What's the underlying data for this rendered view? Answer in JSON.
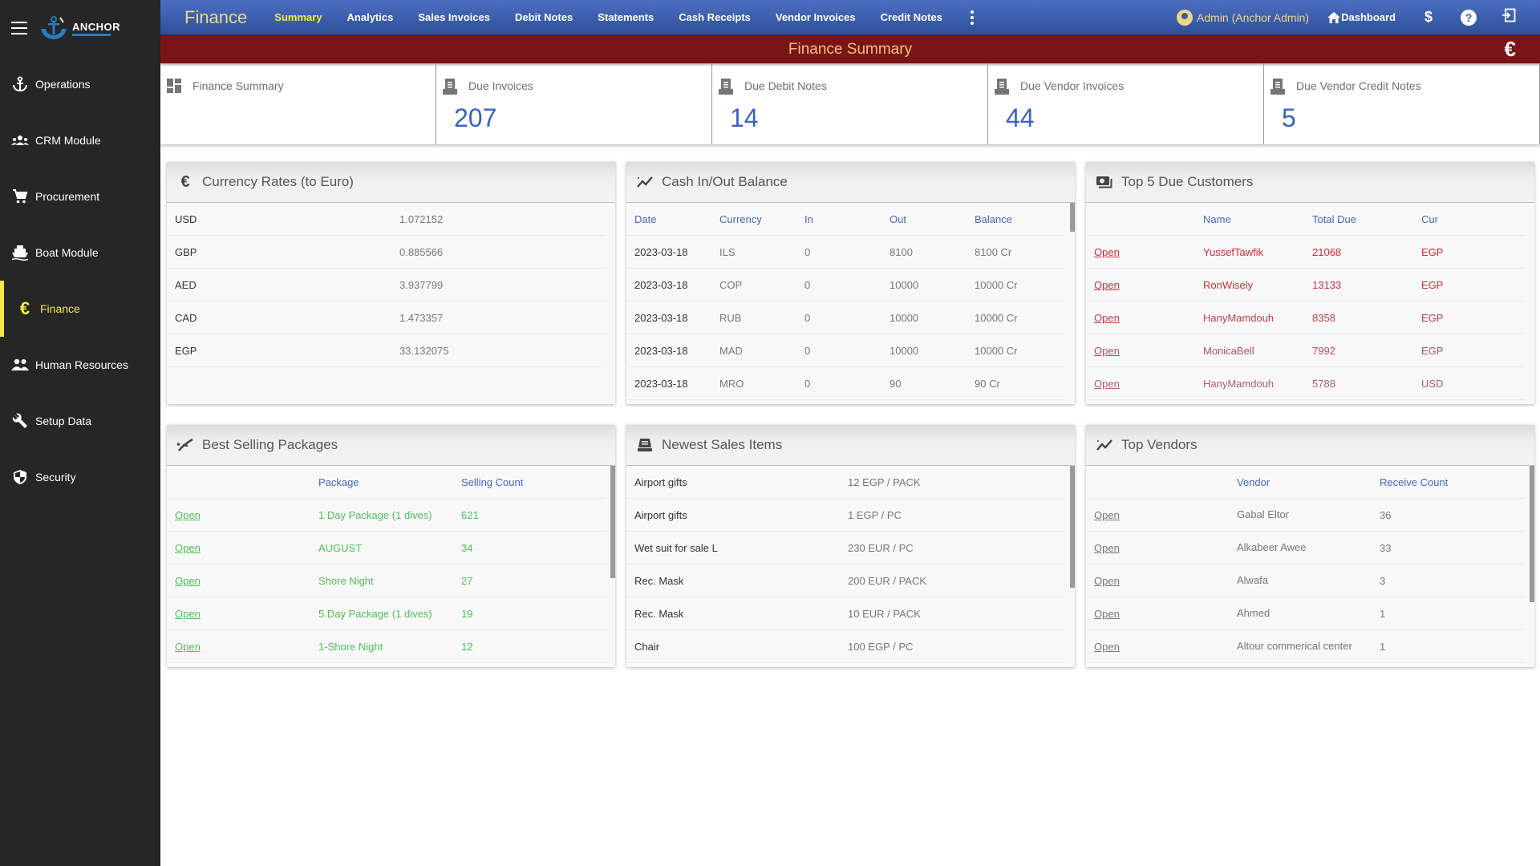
{
  "sidebar": {
    "logo_text": "ANCHOR",
    "items": [
      {
        "label": "Operations",
        "icon": "anchor-icon"
      },
      {
        "label": "CRM Module",
        "icon": "group-icon"
      },
      {
        "label": "Procurement",
        "icon": "cart-icon"
      },
      {
        "label": "Boat Module",
        "icon": "boat-icon"
      },
      {
        "label": "Finance",
        "icon": "euro-icon",
        "active": true
      },
      {
        "label": "Human Resources",
        "icon": "people-icon"
      },
      {
        "label": "Setup Data",
        "icon": "wrench-icon"
      },
      {
        "label": "Security",
        "icon": "shield-icon"
      }
    ]
  },
  "topnav": {
    "brand": "Finance",
    "links": [
      "Summary",
      "Analytics",
      "Sales Invoices",
      "Debit Notes",
      "Statements",
      "Cash Receipts",
      "Vendor Invoices",
      "Credit Notes"
    ],
    "active": "Summary",
    "user": "Admin (Anchor Admin)",
    "dashboard": "Dashboard",
    "dollar": "$",
    "help": "?"
  },
  "titlebar": {
    "title": "Finance Summary",
    "icon": "€"
  },
  "cards": [
    {
      "label": "Finance Summary",
      "value": null,
      "icon": "dashboard-icon"
    },
    {
      "label": "Due Invoices",
      "value": "207",
      "icon": "receipt-icon"
    },
    {
      "label": "Due Debit Notes",
      "value": "14",
      "icon": "receipt-icon"
    },
    {
      "label": "Due Vendor Invoices",
      "value": "44",
      "icon": "receipt-icon"
    },
    {
      "label": "Due Vendor Credit Notes",
      "value": "5",
      "icon": "receipt-icon"
    }
  ],
  "currency_rates": {
    "title": "Currency Rates (to Euro)",
    "icon": "€",
    "rows": [
      {
        "code": "USD",
        "rate": "1.072152"
      },
      {
        "code": "GBP",
        "rate": "0.885566"
      },
      {
        "code": "AED",
        "rate": "3.937799"
      },
      {
        "code": "CAD",
        "rate": "1.473357"
      },
      {
        "code": "EGP",
        "rate": "33.132075"
      }
    ]
  },
  "cash_balance": {
    "title": "Cash In/Out Balance",
    "headers": [
      "Date",
      "Currency",
      "In",
      "Out",
      "Balance"
    ],
    "rows": [
      [
        "2023-03-18",
        "ILS",
        "0",
        "8100",
        "8100 Cr"
      ],
      [
        "2023-03-18",
        "COP",
        "0",
        "10000",
        "10000 Cr"
      ],
      [
        "2023-03-18",
        "RUB",
        "0",
        "10000",
        "10000 Cr"
      ],
      [
        "2023-03-18",
        "MAD",
        "0",
        "10000",
        "10000 Cr"
      ],
      [
        "2023-03-18",
        "MRO",
        "0",
        "90",
        "90 Cr"
      ]
    ]
  },
  "top_customers": {
    "title": "Top 5 Due Customers",
    "headers": [
      "",
      "Name",
      "Total Due",
      "Cur"
    ],
    "open_label": "Open",
    "rows": [
      {
        "name": "YussefTawfik",
        "due": "21068",
        "cur": "EGP",
        "color": "#d6283b"
      },
      {
        "name": "RonWisely",
        "due": "13133",
        "cur": "EGP",
        "color": "#c7303f"
      },
      {
        "name": "HanyMamdouh",
        "due": "8358",
        "cur": "EGP",
        "color": "#bd3f4b"
      },
      {
        "name": "MonicaBell",
        "due": "7992",
        "cur": "EGP",
        "color": "#b4505a"
      },
      {
        "name": "HanyMamdouh",
        "due": "5788",
        "cur": "USD",
        "color": "#a8626a"
      }
    ]
  },
  "best_packages": {
    "title": "Best Selling Packages",
    "headers": [
      "",
      "Package",
      "Selling Count"
    ],
    "open_label": "Open",
    "rows": [
      {
        "name": "1 Day Package (1 dives)",
        "count": "621"
      },
      {
        "name": "AUGUST",
        "count": "34"
      },
      {
        "name": "Shore Night",
        "count": "27"
      },
      {
        "name": "5 Day Package (1 dives)",
        "count": "19"
      },
      {
        "name": "1-Shore Night",
        "count": "12"
      }
    ]
  },
  "newest_items": {
    "title": "Newest Sales Items",
    "rows": [
      {
        "name": "Airport gifts",
        "price": "12 EGP / PACK"
      },
      {
        "name": "Airport gifts",
        "price": "1 EGP / PC"
      },
      {
        "name": "Wet suit for sale L",
        "price": "230 EUR / PC"
      },
      {
        "name": "Rec. Mask",
        "price": "200 EUR / PACK"
      },
      {
        "name": "Rec. Mask",
        "price": "10 EUR / PACK"
      },
      {
        "name": "Chair",
        "price": "100 EGP / PC"
      }
    ]
  },
  "top_vendors": {
    "title": "Top Vendors",
    "headers": [
      "",
      "Vendor",
      "Receive Count"
    ],
    "open_label": "Open",
    "rows": [
      {
        "name": "Gabal Eltor",
        "count": "36"
      },
      {
        "name": "Alkabeer Awee",
        "count": "33"
      },
      {
        "name": "Alwafa",
        "count": "3"
      },
      {
        "name": "Ahmed",
        "count": "1"
      },
      {
        "name": "Altour commerical center",
        "count": "1"
      }
    ]
  }
}
